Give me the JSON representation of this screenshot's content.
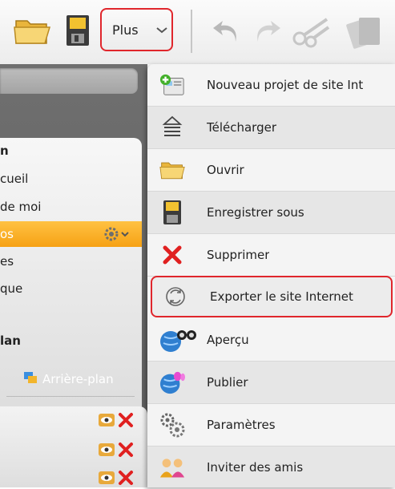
{
  "toolbar": {
    "plus_label": "Plus",
    "icons": [
      "open-folder-icon",
      "save-icon",
      "chevron-down-icon",
      "undo-icon",
      "redo-icon",
      "scissors-icon",
      "copy-icon"
    ]
  },
  "left_panel": {
    "items": [
      {
        "label": "n",
        "bold": true
      },
      {
        "label": "cueil",
        "bold": false
      },
      {
        "label": "de moi",
        "bold": false
      },
      {
        "label": "os",
        "bold": false,
        "selected": true
      },
      {
        "label": "es",
        "bold": false
      },
      {
        "label": "que",
        "bold": false
      },
      {
        "label": "lan",
        "bold": true
      }
    ],
    "background_link": "Arrière-plan"
  },
  "menu": {
    "items": [
      {
        "label": "Nouveau projet de site Int",
        "icon": "new-site-icon"
      },
      {
        "label": "Télécharger",
        "icon": "upload-icon"
      },
      {
        "label": "Ouvrir",
        "icon": "folder-icon"
      },
      {
        "label": "Enregistrer sous",
        "icon": "floppy-icon"
      },
      {
        "label": "Supprimer",
        "icon": "delete-x-icon"
      },
      {
        "label": "Exporter le site Internet",
        "icon": "export-cycle-icon",
        "highlighted": true
      },
      {
        "label": "Aperçu",
        "icon": "binoculars-globe-icon"
      },
      {
        "label": "Publier",
        "icon": "globe-butterfly-icon"
      },
      {
        "label": "Paramètres",
        "icon": "gears-icon"
      },
      {
        "label": "Inviter des amis",
        "icon": "people-icon"
      }
    ]
  },
  "colors": {
    "highlight_red": "#e0262c",
    "selected_orange": "#f6a114",
    "panel_gray": "#666666"
  }
}
